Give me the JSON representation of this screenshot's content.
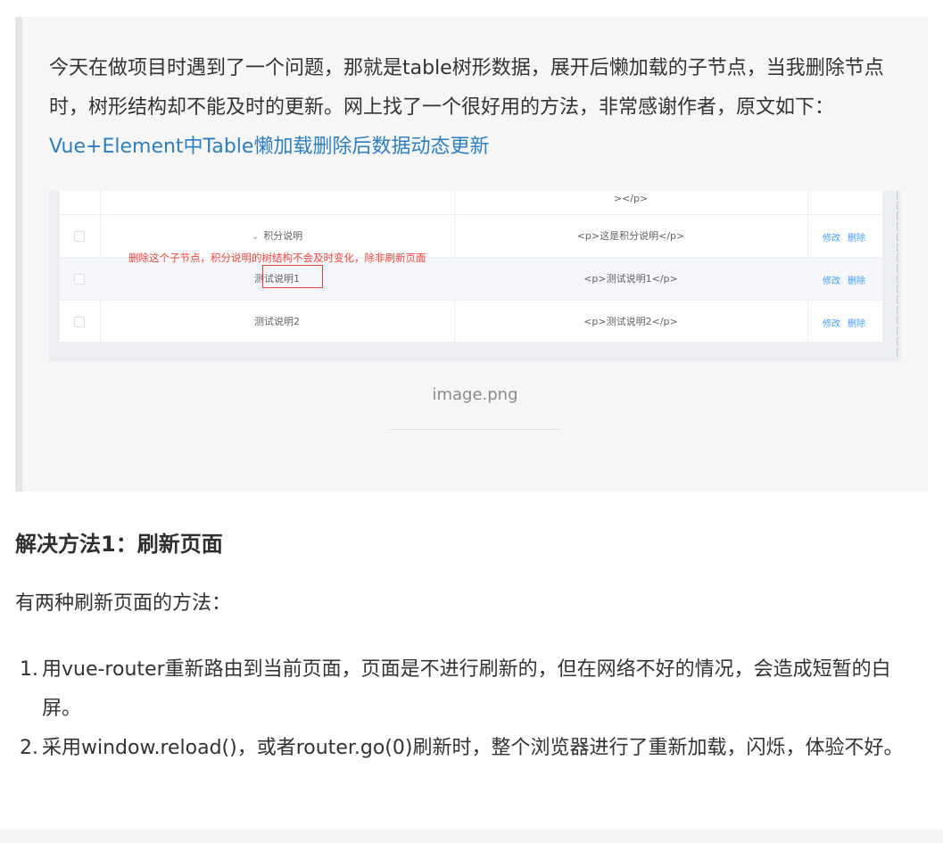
{
  "quote": {
    "text_main": "今天在做项目时遇到了一个问题，那就是table树形数据，展开后懒加载的子节点，当我删除节点时，树形结构却不能及时的更新。网上找了一个很好用的方法，非常感谢作者，原文如下：",
    "link_text": "Vue+Element中Table懒加载删除后数据动态更新"
  },
  "screenshot": {
    "rows": [
      {
        "name": "",
        "content": "></p>",
        "ops": []
      },
      {
        "name": "积分说明",
        "content": "<p>这是积分说明</p>",
        "ops": [
          "修改",
          "删除"
        ]
      },
      {
        "name": "测试说明1",
        "content": "<p>测试说明1</p>",
        "ops": [
          "修改",
          "删除"
        ]
      },
      {
        "name": "测试说明2",
        "content": "<p>测试说明2</p>",
        "ops": [
          "修改",
          "删除"
        ]
      }
    ],
    "annotation": "删除这个子节点，积分说明的树结构不会及时变化，除非刷新页面",
    "annotation_color": "#f0443c"
  },
  "caption": "image.png",
  "section": {
    "heading": "解决方法1：刷新页面",
    "intro": "有两种刷新页面的方法：",
    "items": [
      {
        "num": "1.",
        "text": "用vue-router重新路由到当前页面，页面是不进行刷新的，但在网络不好的情况，会造成短暂的白屏。"
      },
      {
        "num": "2.",
        "text": "采用window.reload()，或者router.go(0)刷新时，整个浏览器进行了重新加载，闪烁，体验不好。"
      }
    ]
  },
  "colors": {
    "link": "#2b7fc3",
    "op_link": "#409eff"
  }
}
